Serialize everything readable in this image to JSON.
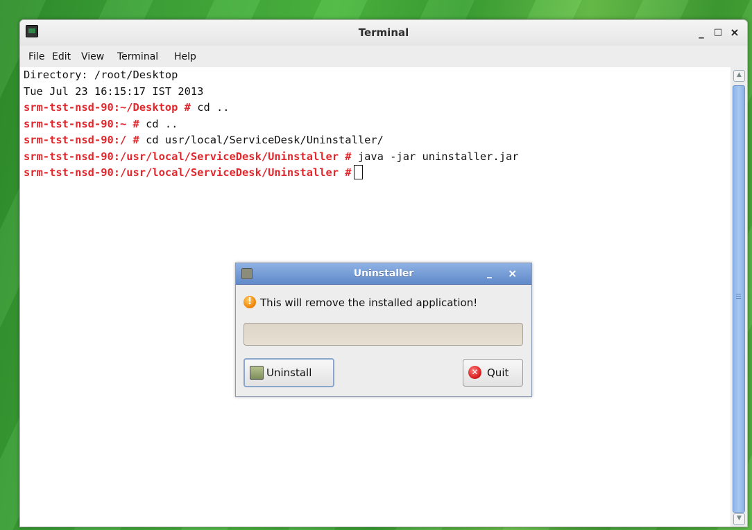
{
  "window": {
    "title": "Terminal",
    "controls": {
      "minimize": "_",
      "maximize": "□",
      "close": "×"
    }
  },
  "menu": [
    "File",
    "Edit",
    "View",
    "Terminal",
    "Help"
  ],
  "terminal": {
    "lines": [
      {
        "prompt": "",
        "text": "Directory: /root/Desktop"
      },
      {
        "prompt": "",
        "text": "Tue Jul 23 16:15:17 IST 2013"
      },
      {
        "prompt": "srm-tst-nsd-90:~/Desktop #",
        "text": " cd .."
      },
      {
        "prompt": "srm-tst-nsd-90:~ #",
        "text": " cd .."
      },
      {
        "prompt": "srm-tst-nsd-90:/ #",
        "text": " cd usr/local/ServiceDesk/Uninstaller/"
      },
      {
        "prompt": "srm-tst-nsd-90:/usr/local/ServiceDesk/Uninstaller #",
        "text": " java -jar uninstaller.jar"
      },
      {
        "prompt": "srm-tst-nsd-90:/usr/local/ServiceDesk/Uninstaller #",
        "text": ""
      }
    ]
  },
  "dialog": {
    "title": "Uninstaller",
    "minimize": "_",
    "close": "×",
    "message": "This will remove the installed application!",
    "warning_glyph": "!",
    "uninstall_label": "Uninstall",
    "quit_label": "Quit",
    "quit_glyph": "✕"
  },
  "scrollbar": {
    "up": "▲",
    "down": "▼"
  }
}
